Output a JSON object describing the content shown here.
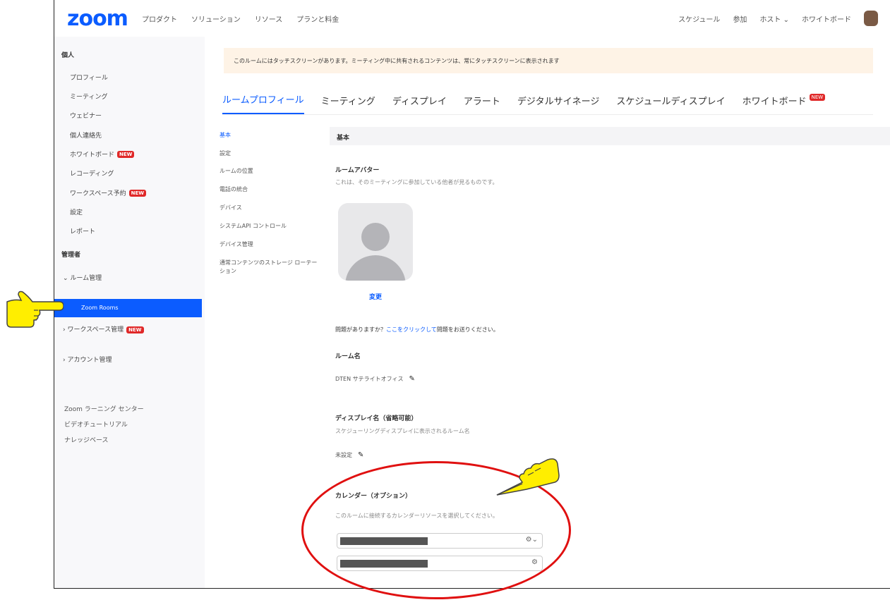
{
  "nav": {
    "logo": "zoom",
    "left_items": [
      "プロダクト",
      "ソリューション",
      "リソース",
      "プランと料金"
    ],
    "right_items": [
      "スケジュール",
      "参加",
      "ホスト ⌄",
      "ホワイトボード"
    ]
  },
  "sidebar": {
    "personal_heading": "個人",
    "items": [
      {
        "label": "プロフィール"
      },
      {
        "label": "ミーティング"
      },
      {
        "label": "ウェビナー"
      },
      {
        "label": "個人連絡先"
      },
      {
        "label": "ホワイトボード",
        "badge": "NEW"
      },
      {
        "label": "レコーディング"
      },
      {
        "label": "ワークスペース予約",
        "badge": "NEW"
      },
      {
        "label": "設定"
      },
      {
        "label": "レポート"
      }
    ],
    "admin_heading": "管理者",
    "room_mgmt": "⌄ ルーム管理",
    "zoom_rooms": "Zoom Rooms",
    "workspace_mgmt": "› ワークスペース管理",
    "workspace_badge": "NEW",
    "account_mgmt": "› アカウント管理",
    "links": [
      "Zoom ラーニング センター",
      "ビデオチュートリアル",
      "ナレッジベース"
    ]
  },
  "banner": "このルームにはタッチスクリーンがあります。ミーティング中に共有されるコンテンツは、常にタッチスクリーンに表示されます",
  "tabs": [
    "ルームプロフィール",
    "ミーティング",
    "ディスプレイ",
    "アラート",
    "デジタルサイネージ",
    "スケジュールディスプレイ",
    "ホワイトボード"
  ],
  "tabs_new_badge": "NEW",
  "subnav": [
    "基本",
    "設定",
    "ルームの位置",
    "電話の統合",
    "デバイス",
    "システムAPI コントロール",
    "デバイス管理",
    "通常コンテンツのストレージ ローテーション"
  ],
  "section_title": "基本",
  "room_avatar": {
    "label": "ルームアバター",
    "desc": "これは、そのミーティングに参加している他者が見るものです。",
    "change": "変更"
  },
  "problem": {
    "prefix": "問題がありますか？",
    "link": "ここをクリックして",
    "suffix": "問題をお送りください。"
  },
  "room_name": {
    "label": "ルーム名",
    "value": "DTEN サテライトオフィス"
  },
  "display_name": {
    "label": "ディスプレイ名（省略可能）",
    "desc": "スケジューリングディスプレイに表示されるルーム名",
    "value": "未設定"
  },
  "calendar": {
    "label": "カレンダー（オプション）",
    "desc": "このルームに接続するカレンダーリソースを選択してください。"
  },
  "colors": {
    "accent": "#0b5cff",
    "badge": "#e02828",
    "annotation": "#e01010",
    "hand": "#ffee00"
  }
}
